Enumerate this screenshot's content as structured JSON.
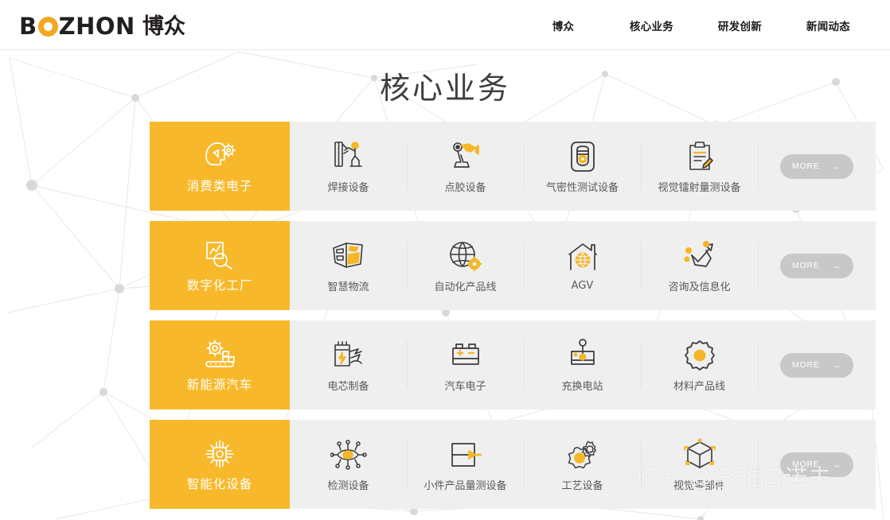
{
  "header": {
    "logo": {
      "latin_pre": "B",
      "logo_o": "O",
      "latin_post": "ZHON",
      "chinese": "博众",
      "o_color": "#f0a820"
    },
    "nav": [
      {
        "label": "博众",
        "name": "nav-bozhon"
      },
      {
        "label": "核心业务",
        "name": "nav-core-business"
      },
      {
        "label": "研发创新",
        "name": "nav-rnd-innovation"
      },
      {
        "label": "新闻动态",
        "name": "nav-news"
      }
    ]
  },
  "page": {
    "title": "核心业务",
    "accent_color": "#f7b92b",
    "panel_color": "#efefef",
    "more_button_color": "#c8c8c8"
  },
  "rows": [
    {
      "head_label": "消费类电子",
      "head_icon": "head-gear-icon",
      "more_label": "MORE",
      "more_arrow": "←",
      "items": [
        {
          "label": "焊接设备",
          "icon": "welding-worker-icon"
        },
        {
          "label": "点胶设备",
          "icon": "robot-arm-dispenser-icon"
        },
        {
          "label": "气密性测试设备",
          "icon": "airtightness-tester-icon"
        },
        {
          "label": "视觉镭射量测设备",
          "icon": "clipboard-pencil-icon"
        }
      ]
    },
    {
      "head_label": "数字化工厂",
      "head_icon": "chart-magnifier-icon",
      "more_label": "MORE",
      "more_arrow": "←",
      "items": [
        {
          "label": "智慧物流",
          "icon": "map-logistics-icon"
        },
        {
          "label": "自动化产品线",
          "icon": "globe-gear-icon"
        },
        {
          "label": "AGV",
          "icon": "warehouse-globe-icon"
        },
        {
          "label": "咨询及信息化",
          "icon": "arrow-network-icon"
        }
      ]
    },
    {
      "head_label": "新能源汽车",
      "head_icon": "gear-conveyor-icon",
      "more_label": "MORE",
      "more_arrow": "←",
      "items": [
        {
          "label": "电芯制备",
          "icon": "battery-cell-icon"
        },
        {
          "label": "汽车电子",
          "icon": "car-battery-icon"
        },
        {
          "label": "充换电站",
          "icon": "charging-station-icon"
        },
        {
          "label": "材料产品线",
          "icon": "gear-solid-icon"
        }
      ]
    },
    {
      "head_label": "智能化设备",
      "head_icon": "chip-circuit-icon",
      "more_label": "MORE",
      "more_arrow": "←",
      "items": [
        {
          "label": "检测设备",
          "icon": "smart-eye-icon"
        },
        {
          "label": "小件产品量测设备",
          "icon": "box-arrow-icon"
        },
        {
          "label": "工艺设备",
          "icon": "double-gear-icon"
        },
        {
          "label": "视觉零部件",
          "icon": "cube-3d-icon"
        }
      ]
    }
  ],
  "watermark": {
    "text": "知乎 @李雅普诺夫"
  }
}
